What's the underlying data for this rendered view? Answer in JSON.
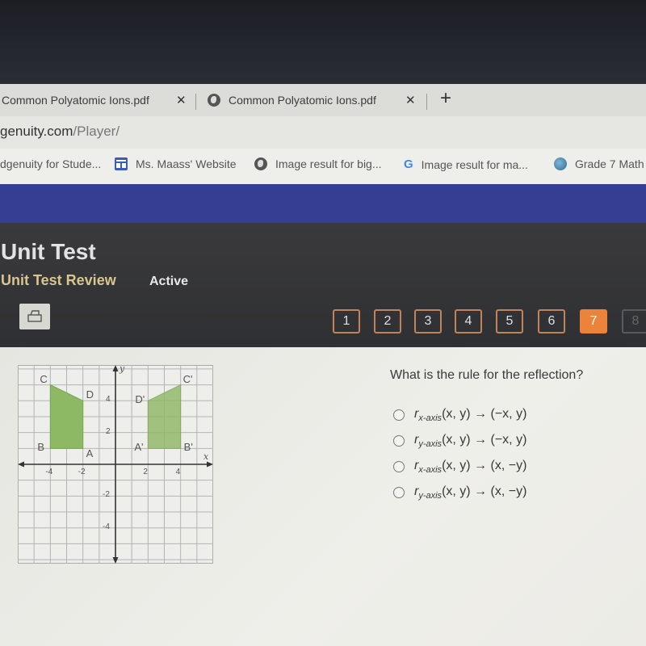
{
  "browser": {
    "tabs": [
      {
        "title": "Common Polyatomic Ions.pdf",
        "icon": "none",
        "close": "✕"
      },
      {
        "title": "Common Polyatomic Ions.pdf",
        "icon": "globe-icon",
        "close": "✕"
      }
    ],
    "new_tab": "+",
    "url": {
      "host": "genuity.com",
      "path": "/Player/"
    },
    "bookmarks": [
      {
        "label": "dgenuity for Stude...",
        "icon": "none"
      },
      {
        "label": "Ms. Maass' Website",
        "icon": "site-icon"
      },
      {
        "label": "Image result for big...",
        "icon": "globe-icon"
      },
      {
        "label": "Image result for ma...",
        "icon": "google-icon"
      },
      {
        "label": "Grade 7 Math",
        "icon": "earth-icon"
      }
    ]
  },
  "header": {
    "title": "Unit Test",
    "subtitle": "Unit Test Review",
    "status": "Active"
  },
  "question_nav": {
    "items": [
      "1",
      "2",
      "3",
      "4",
      "5",
      "6",
      "7",
      "8"
    ],
    "active": "7",
    "disabled": [
      "8"
    ],
    "active_color": "#ec833a"
  },
  "graph": {
    "x_axis_label": "x",
    "y_axis_label": "y",
    "x_ticks": [
      "-4",
      "-2",
      "2",
      "4"
    ],
    "y_ticks": [
      "4",
      "2",
      "-2",
      "-4"
    ],
    "x_range": [
      -6,
      6
    ],
    "y_range": [
      -6.25,
      6.25
    ],
    "fill_color": "#8db864",
    "figures": [
      {
        "name": "ABCD",
        "points": [
          {
            "label": "A",
            "x": -2,
            "y": 1
          },
          {
            "label": "B",
            "x": -4,
            "y": 1
          },
          {
            "label": "C",
            "x": -4,
            "y": 5
          },
          {
            "label": "D",
            "x": -2,
            "y": 4
          }
        ]
      },
      {
        "name": "A'B'C'D'",
        "points": [
          {
            "label": "A'",
            "x": 2,
            "y": 1
          },
          {
            "label": "B'",
            "x": 4,
            "y": 1
          },
          {
            "label": "C'",
            "x": 4,
            "y": 5
          },
          {
            "label": "D'",
            "x": 2,
            "y": 4
          }
        ]
      }
    ]
  },
  "question": {
    "prompt": "What is the rule for the reflection?",
    "options": [
      {
        "fn": "r",
        "sub": "x-axis",
        "rule": "(x, y) → (−x, y)"
      },
      {
        "fn": "r",
        "sub": "y-axis",
        "rule": "(x, y) → (−x, y)"
      },
      {
        "fn": "r",
        "sub": "x-axis",
        "rule": "(x, y) → (x, −y)"
      },
      {
        "fn": "r",
        "sub": "y-axis",
        "rule": "(x, y) → (x, −y)"
      }
    ]
  }
}
